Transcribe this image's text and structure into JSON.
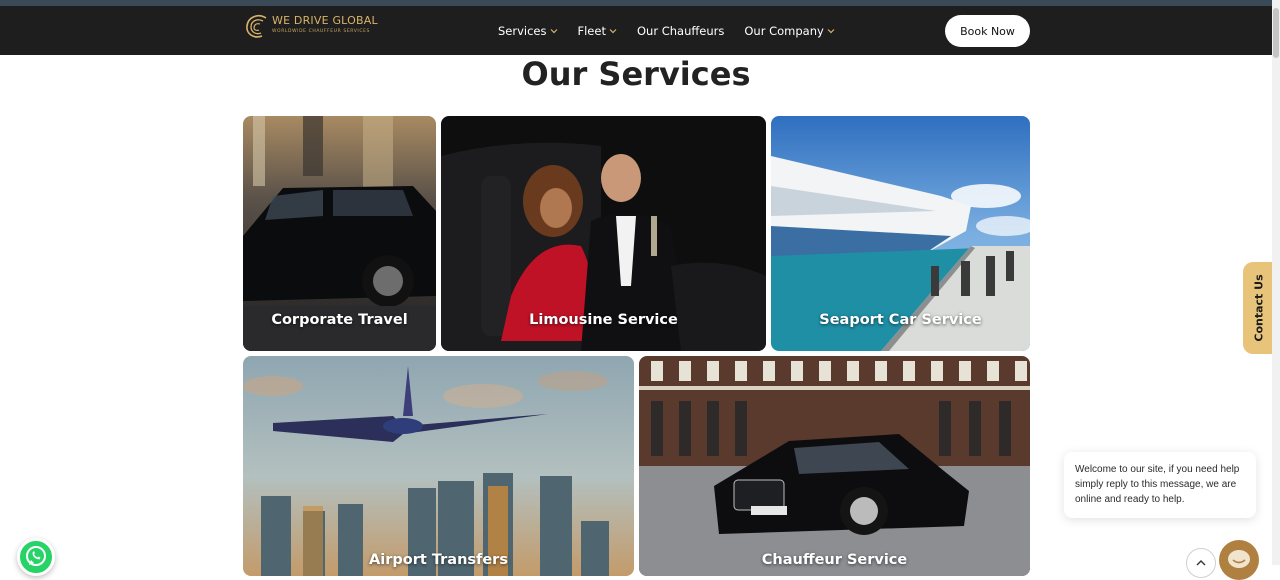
{
  "brand": {
    "name": "WE DRIVE GLOBAL",
    "tagline": "WORLDWIDE CHAUFFEUR SERVICES",
    "accent": "#d9b36a"
  },
  "nav": {
    "items": [
      {
        "label": "Services",
        "dropdown": true
      },
      {
        "label": "Fleet",
        "dropdown": true
      },
      {
        "label": "Our Chauffeurs",
        "dropdown": false
      },
      {
        "label": "Our Company",
        "dropdown": true
      }
    ],
    "cta": "Book Now"
  },
  "section": {
    "title": "Our Services"
  },
  "services": [
    {
      "label": "Corporate Travel"
    },
    {
      "label": "Limousine Service"
    },
    {
      "label": "Seaport Car Service"
    },
    {
      "label": "Airport Transfers"
    },
    {
      "label": "Chauffeur Service"
    }
  ],
  "contact_tab": {
    "label": "Contact Us"
  },
  "chat": {
    "message": "Welcome to our site, if you need help simply reply to this message, we are online and ready to help."
  },
  "icons": {
    "whatsapp": "whatsapp-icon",
    "scroll_top": "chevron-up-icon",
    "chat": "chat-icon"
  },
  "colors": {
    "navbar": "#1e1e1e",
    "contact_tab": "#e8c47a",
    "whatsapp": "#25d366"
  }
}
